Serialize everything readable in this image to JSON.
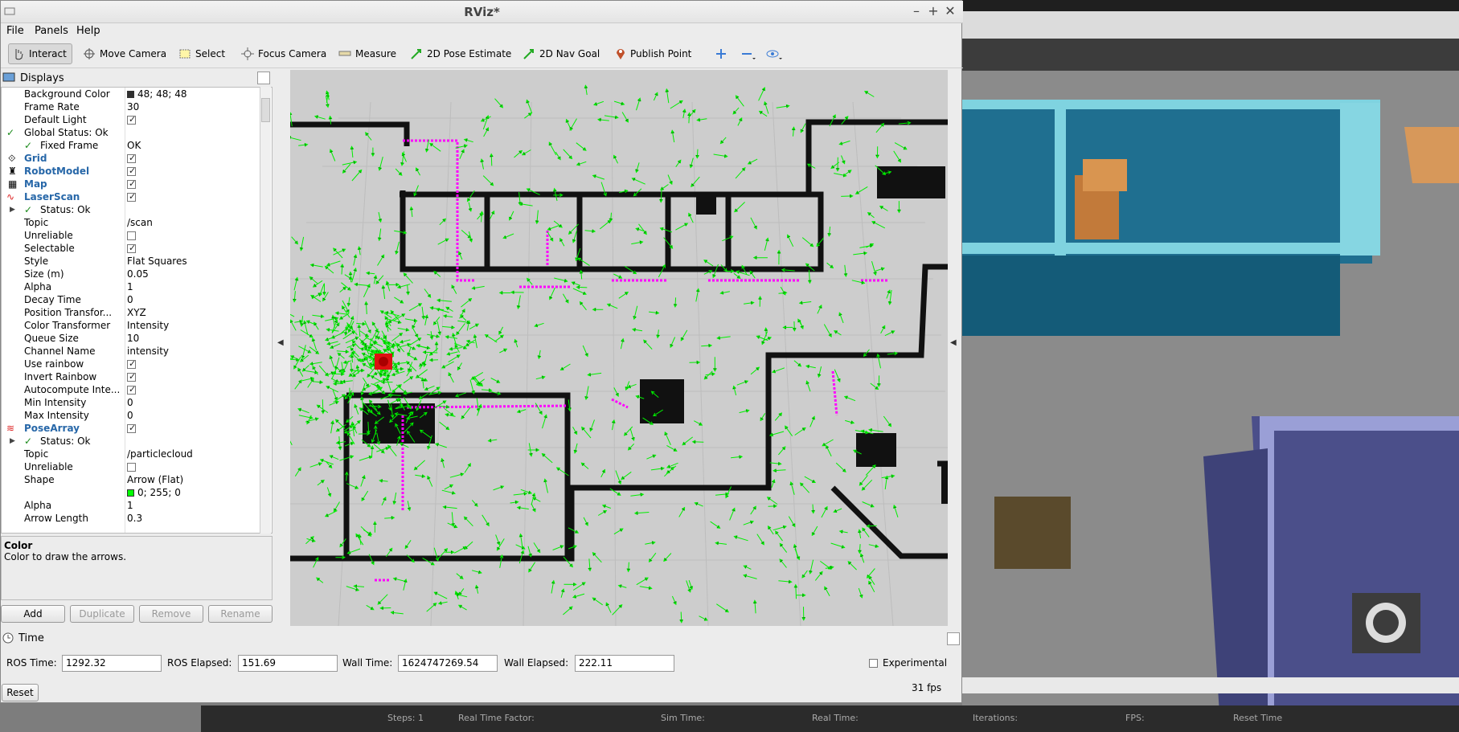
{
  "window": {
    "title": "RViz*",
    "minimize": "–",
    "maximize": "+",
    "close": "✕"
  },
  "menu": {
    "file": "File",
    "panels": "Panels",
    "help": "Help"
  },
  "toolbar": {
    "interact": "Interact",
    "move_camera": "Move Camera",
    "select": "Select",
    "focus_camera": "Focus Camera",
    "measure": "Measure",
    "pose_estimate": "2D Pose Estimate",
    "nav_goal": "2D Nav Goal",
    "publish_point": "Publish Point"
  },
  "displays": {
    "title": "Displays",
    "rows": {
      "background_color": {
        "name": "Background Color",
        "value": "48; 48; 48"
      },
      "frame_rate": {
        "name": "Frame Rate",
        "value": "30"
      },
      "default_light": {
        "name": "Default Light"
      },
      "global_status": {
        "name": "Global Status: Ok"
      },
      "fixed_frame": {
        "name": "Fixed Frame",
        "value": "OK"
      },
      "grid": {
        "name": "Grid"
      },
      "robot_model": {
        "name": "RobotModel"
      },
      "map": {
        "name": "Map"
      },
      "laserscan": {
        "name": "LaserScan"
      },
      "ls_status": {
        "name": "Status: Ok"
      },
      "ls_topic": {
        "name": "Topic",
        "value": "/scan"
      },
      "ls_unreliable": {
        "name": "Unreliable"
      },
      "ls_selectable": {
        "name": "Selectable"
      },
      "ls_style": {
        "name": "Style",
        "value": "Flat Squares"
      },
      "ls_size": {
        "name": "Size (m)",
        "value": "0.05"
      },
      "ls_alpha": {
        "name": "Alpha",
        "value": "1"
      },
      "ls_decay": {
        "name": "Decay Time",
        "value": "0"
      },
      "ls_pos_transformer": {
        "name": "Position Transfor...",
        "value": "XYZ"
      },
      "ls_color_transformer": {
        "name": "Color Transformer",
        "value": "Intensity"
      },
      "ls_queue": {
        "name": "Queue Size",
        "value": "10"
      },
      "ls_channel": {
        "name": "Channel Name",
        "value": "intensity"
      },
      "ls_rainbow": {
        "name": "Use rainbow"
      },
      "ls_invert": {
        "name": "Invert Rainbow"
      },
      "ls_autocompute": {
        "name": "Autocompute Inte..."
      },
      "ls_min": {
        "name": "Min Intensity",
        "value": "0"
      },
      "ls_max": {
        "name": "Max Intensity",
        "value": "0"
      },
      "posearray": {
        "name": "PoseArray"
      },
      "pa_status": {
        "name": "Status: Ok"
      },
      "pa_topic": {
        "name": "Topic",
        "value": "/particlecloud"
      },
      "pa_unreliable": {
        "name": "Unreliable"
      },
      "pa_shape": {
        "name": "Shape",
        "value": "Arrow (Flat)"
      },
      "pa_color": {
        "name": "Color",
        "value": "0; 255; 0"
      },
      "pa_alpha": {
        "name": "Alpha",
        "value": "1"
      },
      "pa_arrow_length": {
        "name": "Arrow Length",
        "value": "0.3"
      }
    },
    "description_title": "Color",
    "description_text": "Color to draw the arrows.",
    "buttons": {
      "add": "Add",
      "duplicate": "Duplicate",
      "remove": "Remove",
      "rename": "Rename"
    }
  },
  "time": {
    "title": "Time",
    "ros_time_label": "ROS Time:",
    "ros_time": "1292.32",
    "ros_elapsed_label": "ROS Elapsed:",
    "ros_elapsed": "151.69",
    "wall_time_label": "Wall Time:",
    "wall_time": "1624747269.54",
    "wall_elapsed_label": "Wall Elapsed:",
    "wall_elapsed": "222.11",
    "experimental": "Experimental",
    "reset": "Reset",
    "fps": "31 fps"
  },
  "colors": {
    "background": "#303030",
    "particle": "#00ff00",
    "laser": "#ff00ff",
    "selection": "#308cc6"
  },
  "gazebo_bottom": {
    "steps": "Steps: 1",
    "rtf": "Real Time Factor:",
    "sim_time": "Sim Time:",
    "real_time": "Real Time:",
    "iterations": "Iterations:",
    "fps": "FPS:",
    "reset": "Reset Time"
  }
}
